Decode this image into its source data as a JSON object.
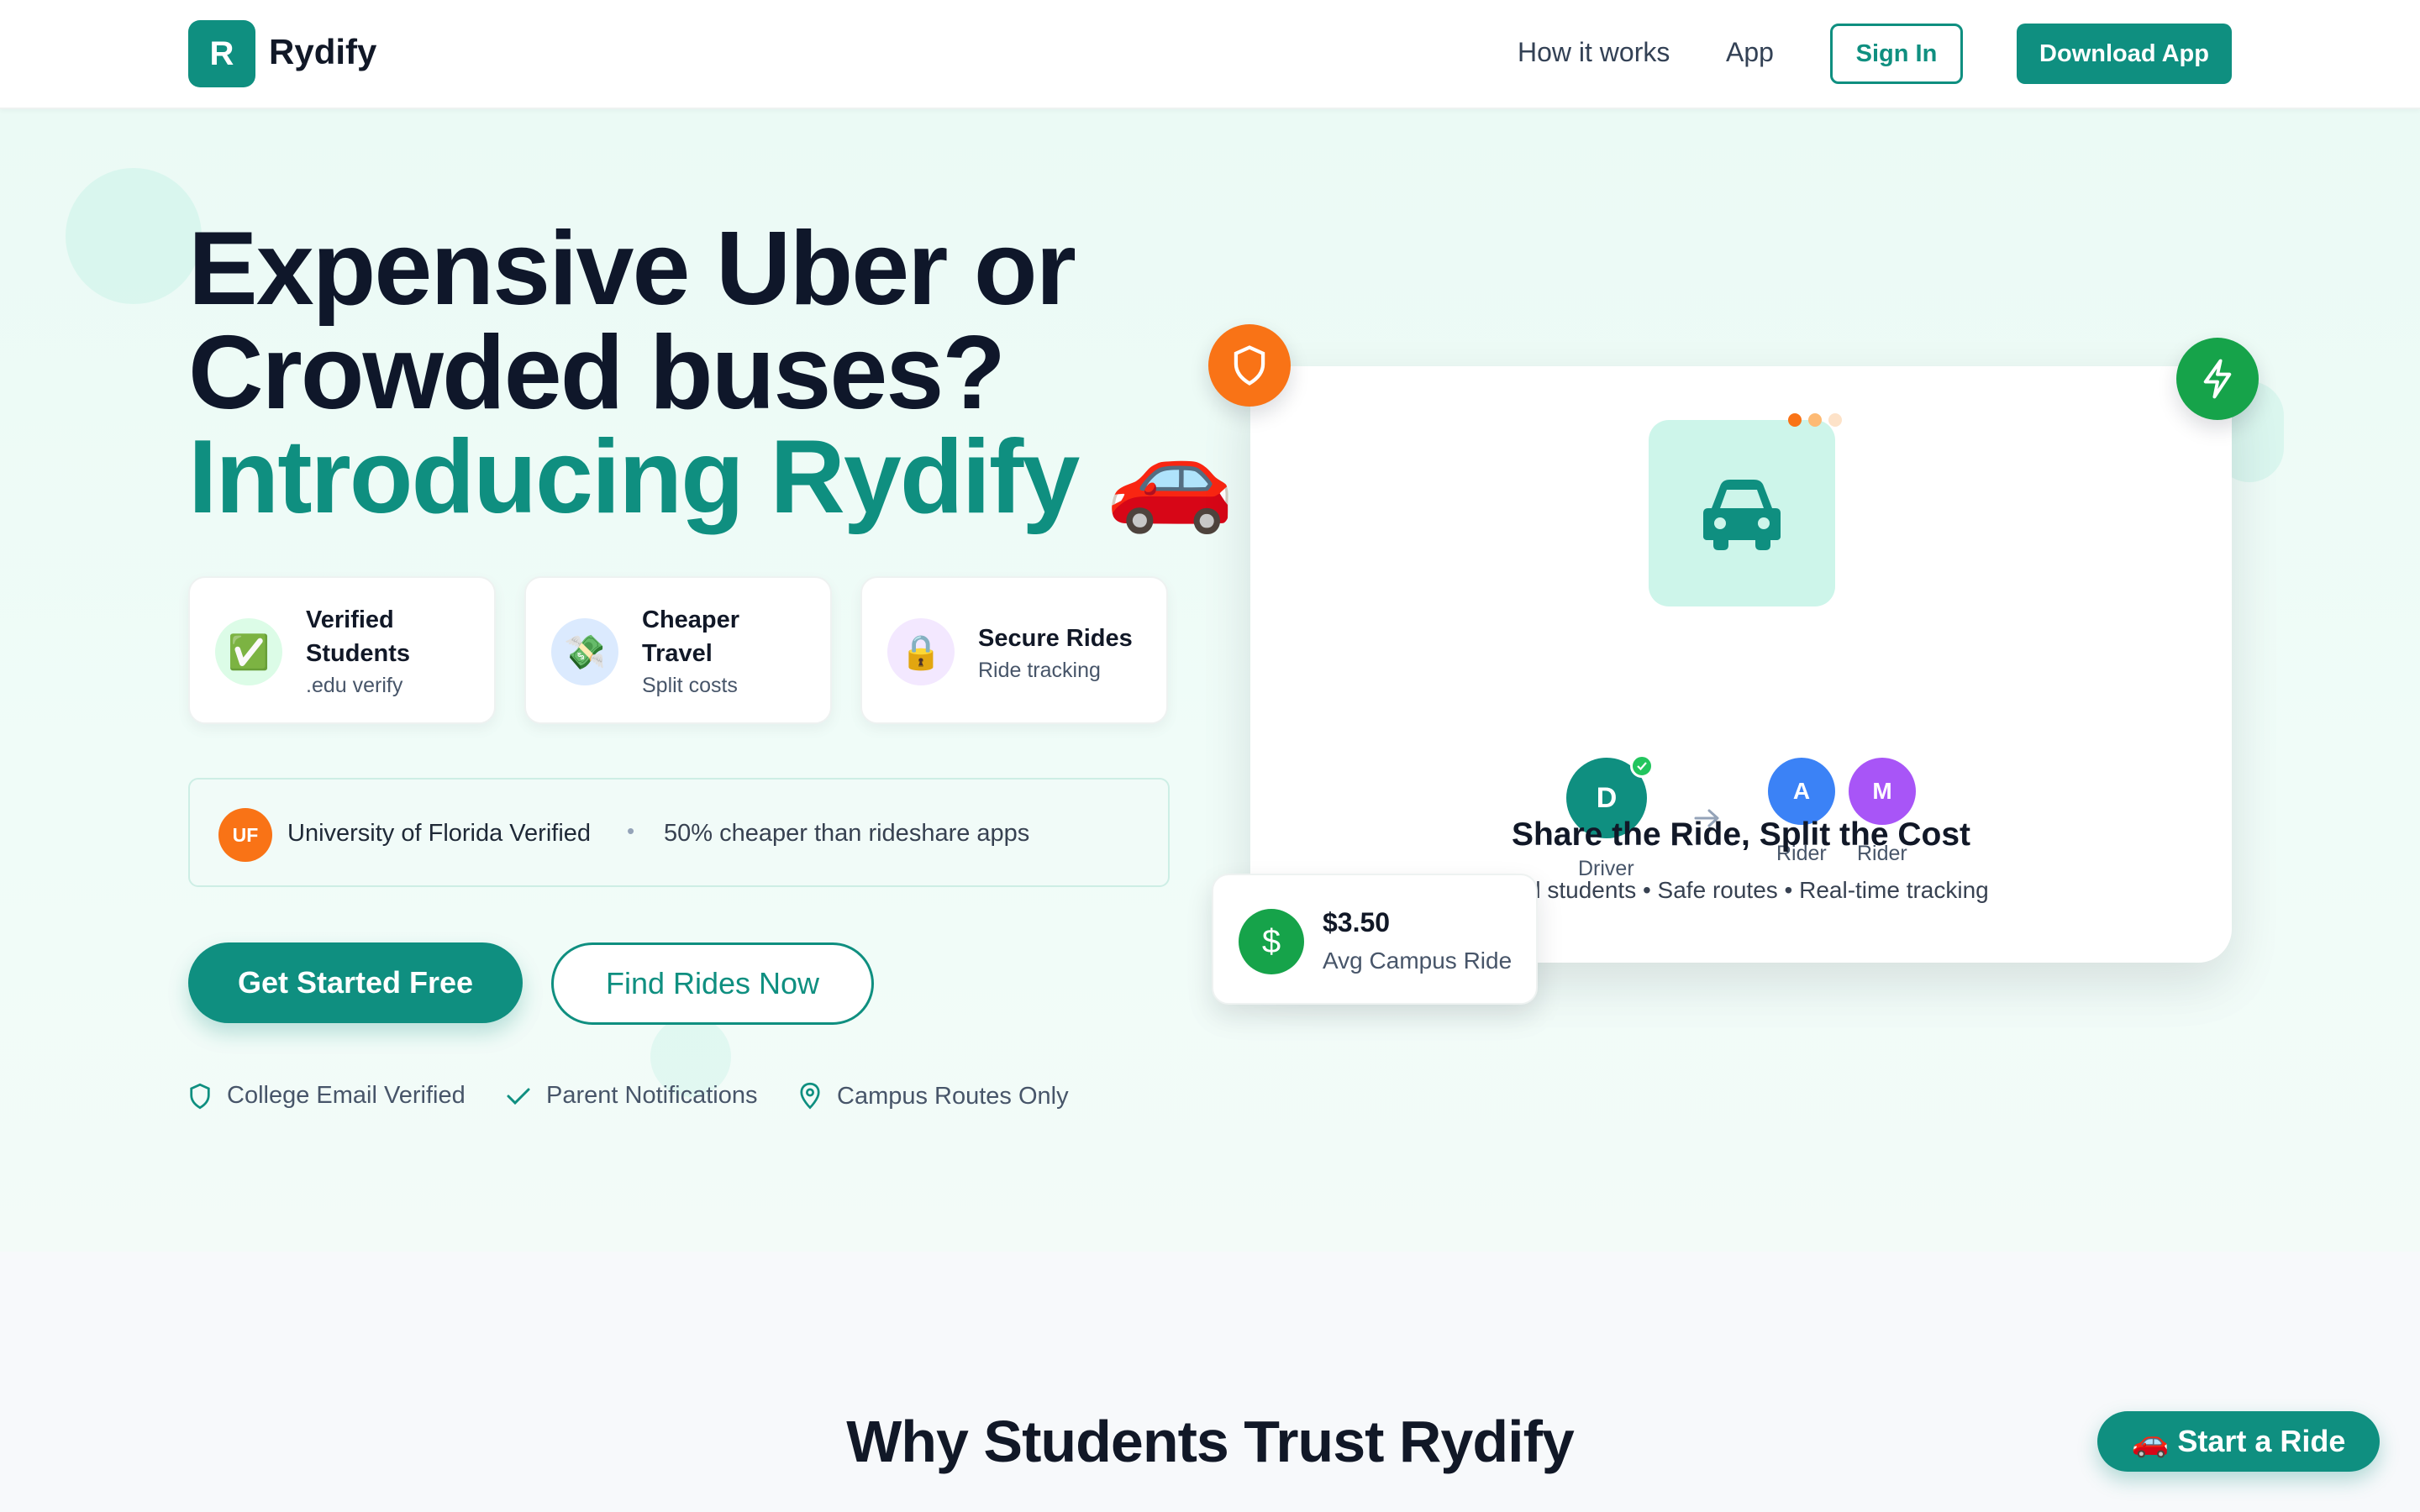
{
  "nav": {
    "logo_letter": "R",
    "brand": "Rydify",
    "links": [
      "How it works",
      "App"
    ],
    "sign_in": "Sign In",
    "download": "Download App"
  },
  "hero": {
    "headline_line1": "Expensive Uber or",
    "headline_line2": "Crowded buses?",
    "headline_line3": "Introducing Rydify 🚗",
    "features": [
      {
        "icon": "✅",
        "title_line1": "Verified",
        "title_line2": "Students",
        "subtitle": ".edu verify"
      },
      {
        "icon": "💸",
        "title_line1": "Cheaper",
        "title_line2": "Travel",
        "subtitle": "Split costs"
      },
      {
        "icon": "🔒",
        "title_line1": "Secure Rides",
        "title_line2": "",
        "subtitle": "Ride tracking"
      }
    ],
    "verified_badge": "UF",
    "verified_text": "University of Florida Verified",
    "separator": "•",
    "cheaper_text": "50% cheaper than rideshare apps",
    "cta_primary": "Get Started Free",
    "cta_secondary": "Find Rides Now",
    "trust": [
      "College Email Verified",
      "Parent Notifications",
      "Campus Routes Only"
    ]
  },
  "card": {
    "driver_initial": "D",
    "driver_label": "Driver",
    "riders": [
      {
        "initial": "A",
        "label": "Rider",
        "color": "#3b82f6"
      },
      {
        "initial": "M",
        "label": "Rider",
        "color": "#a855f7"
      }
    ],
    "title": "Share the Ride, Split the Cost",
    "subtitle": "d students • Safe routes • Real-time tracking",
    "price": "$3.50",
    "price_label": "Avg Campus Ride"
  },
  "section2": {
    "title": "Why Students Trust Rydify"
  },
  "fab": {
    "label": "🚗 Start a Ride"
  },
  "colors": {
    "brand": "#0f8f80",
    "orange": "#f97316",
    "green": "#16a34a"
  }
}
